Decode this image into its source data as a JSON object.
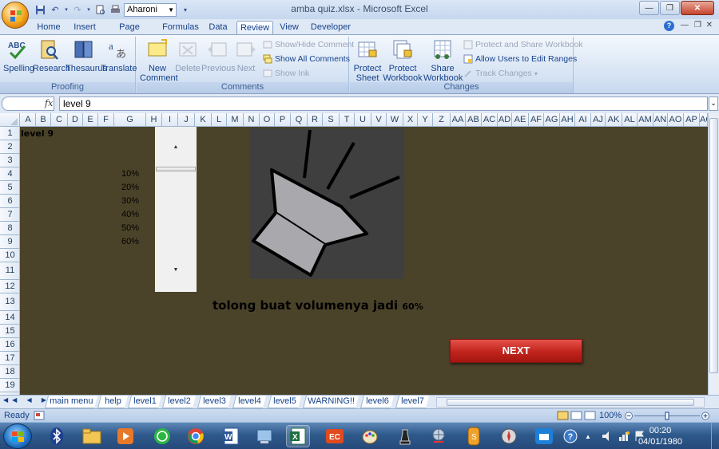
{
  "window": {
    "title": "amba quiz.xlsx - Microsoft Excel",
    "font_name": "Aharoni"
  },
  "ribbon_tabs": [
    "Home",
    "Insert",
    "Page Layout",
    "Formulas",
    "Data",
    "Review",
    "View",
    "Developer"
  ],
  "active_tab": "Review",
  "ribbon": {
    "proofing": {
      "label": "Proofing",
      "spelling": "Spelling",
      "research": "Research",
      "thesaurus": "Thesaurus",
      "translate": "Translate"
    },
    "comments": {
      "label": "Comments",
      "new_line1": "New",
      "new_line2": "Comment",
      "delete": "Delete",
      "previous": "Previous",
      "next": "Next",
      "show_hide": "Show/Hide Comment",
      "show_all": "Show All Comments",
      "show_ink": "Show Ink"
    },
    "changes": {
      "label": "Changes",
      "protect_sheet_1": "Protect",
      "protect_sheet_2": "Sheet",
      "protect_wb_1": "Protect",
      "protect_wb_2": "Workbook",
      "share_wb_1": "Share",
      "share_wb_2": "Workbook",
      "protect_share": "Protect and Share Workbook",
      "allow_users": "Allow Users to Edit Ranges",
      "track_changes": "Track Changes"
    }
  },
  "formula_bar": {
    "fx": "fx",
    "value": "level 9"
  },
  "columns": [
    "A",
    "B",
    "C",
    "D",
    "E",
    "F",
    "G",
    "H",
    "I",
    "J",
    "K",
    "L",
    "M",
    "N",
    "O",
    "P",
    "Q",
    "R",
    "S",
    "T",
    "U",
    "V",
    "W",
    "X",
    "Y",
    "Z",
    "AA",
    "AB",
    "AC",
    "AD",
    "AE",
    "AF",
    "AG",
    "AH",
    "AI",
    "AJ",
    "AK",
    "AL",
    "AM",
    "AN",
    "AO",
    "AP",
    "AQ"
  ],
  "rows": [
    "1",
    "2",
    "3",
    "4",
    "5",
    "6",
    "7",
    "8",
    "9",
    "10",
    "11",
    "12",
    "13",
    "14",
    "15",
    "16",
    "17",
    "18",
    "19"
  ],
  "sheet": {
    "level_label": "level 9",
    "percent_options": [
      "10%",
      "20%",
      "30%",
      "40%",
      "50%",
      "60%"
    ],
    "instruction": "tolong buat volumenya jadi",
    "instruction_target": "60%",
    "next_button": "NEXT"
  },
  "sheet_tabs": [
    "main menu",
    "help",
    "level1",
    "level2",
    "level3",
    "level4",
    "level5",
    "WARNING!!",
    "level6",
    "level7"
  ],
  "status": {
    "ready": "Ready",
    "zoom": "100%"
  },
  "taskbar": {
    "time": "00:20",
    "date": "04/01/1980"
  },
  "colors": {
    "sheet_background": "#4b4329",
    "next_button": "#c0231b",
    "speaker_panel": "#3f3f3f",
    "speaker_fill": "#a9a9ad"
  }
}
